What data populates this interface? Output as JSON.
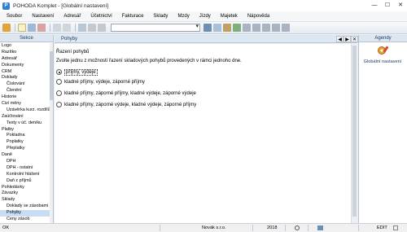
{
  "window": {
    "title": "POHODA Komplet - [Globální nastavení]",
    "app_icon_glyph": "P",
    "minimize_glyph": "—",
    "maximize_glyph": "☐",
    "close_glyph": "✕"
  },
  "menu": [
    "Soubor",
    "Nastavení",
    "Adresář",
    "Účetnictví",
    "Fakturace",
    "Sklady",
    "Mzdy",
    "Jízdy",
    "Majetek",
    "Nápověda"
  ],
  "left_panel": {
    "header": "Sekce",
    "items": [
      {
        "label": "Logo",
        "level": 1
      },
      {
        "label": "Razítko",
        "level": 1
      },
      {
        "label": "Adresář",
        "level": 1
      },
      {
        "label": "Dokumenty",
        "level": 1
      },
      {
        "label": "CRM",
        "level": 1
      },
      {
        "label": "Doklady",
        "level": 1
      },
      {
        "label": "Číslování",
        "level": 2
      },
      {
        "label": "Členění",
        "level": 2
      },
      {
        "label": "Historie",
        "level": 1
      },
      {
        "label": "Cizí měny",
        "level": 1
      },
      {
        "label": "Uzávěrka kurz. rozdílů",
        "level": 2
      },
      {
        "label": "Zaúčtování",
        "level": 1
      },
      {
        "label": "Texty v úč. deníku",
        "level": 2
      },
      {
        "label": "Platby",
        "level": 1
      },
      {
        "label": "Pokladna",
        "level": 2
      },
      {
        "label": "Poplatky",
        "level": 2
      },
      {
        "label": "Přeplatky",
        "level": 2
      },
      {
        "label": "Daně",
        "level": 1
      },
      {
        "label": "DPH",
        "level": 2
      },
      {
        "label": "DPH - ostatní",
        "level": 2
      },
      {
        "label": "Kontrolní hlášení",
        "level": 2
      },
      {
        "label": "Daň z příjmů",
        "level": 2
      },
      {
        "label": "Pohledávky",
        "level": 1
      },
      {
        "label": "Závazky",
        "level": 1
      },
      {
        "label": "Sklady",
        "level": 1
      },
      {
        "label": "Doklady se zásobami",
        "level": 2
      },
      {
        "label": "Pohyby",
        "level": 2,
        "selected": true
      },
      {
        "label": "Ceny zásob",
        "level": 2
      }
    ]
  },
  "tab": {
    "label": "Pohyby",
    "nav_prev": "◀",
    "nav_next": "▶",
    "nav_close": "✕"
  },
  "content": {
    "section_title": "Řazení pohybů",
    "instruction": "Zvolte jednu z možností řazení skladových pohybů provedených v rámci jednoho dne.",
    "options": [
      {
        "label": "příjmy, výdeje",
        "checked": true
      },
      {
        "label": "kladné příjmy, výdeje, záporné příjmy",
        "checked": false
      },
      {
        "label": "kladné příjmy, záporné příjmy, kladné výdeje, záporné výdeje",
        "checked": false
      },
      {
        "label": "kladné příjmy, záporné výdeje, kladné výdeje, záporné příjmy",
        "checked": false
      }
    ]
  },
  "right_panel": {
    "header": "Agendy",
    "item_label": "Globální nastavení"
  },
  "status": {
    "left": "OK",
    "company": "Novák s.r.o.",
    "year": "2018",
    "mode": "EDIT"
  },
  "colors": {
    "accent": "#2f7fd6",
    "panel_header": "#dde7f2",
    "selection": "#c8dcf2"
  }
}
